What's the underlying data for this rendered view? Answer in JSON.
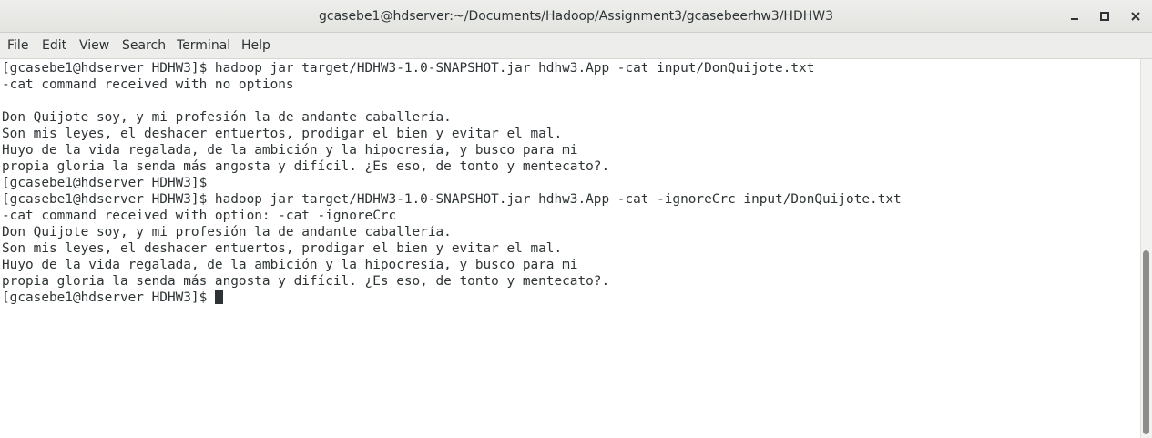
{
  "window": {
    "title": "gcasebe1@hdserver:~/Documents/Hadoop/Assignment3/gcasebeerhw3/HDHW3",
    "controls": {
      "minimize_icon": "minimize-icon",
      "maximize_icon": "maximize-icon",
      "close_icon": "close-icon"
    }
  },
  "menubar": {
    "items": [
      "File",
      "Edit",
      "View",
      "Search",
      "Terminal",
      "Help"
    ]
  },
  "terminal": {
    "lines": [
      "[gcasebe1@hdserver HDHW3]$ hadoop jar target/HDHW3-1.0-SNAPSHOT.jar hdhw3.App -cat input/DonQuijote.txt",
      "-cat command received with no options",
      "",
      "Don Quijote soy, y mi profesión la de andante caballería.",
      "Son mis leyes, el deshacer entuertos, prodigar el bien y evitar el mal.",
      "Huyo de la vida regalada, de la ambición y la hipocresía, y busco para mi",
      "propia gloria la senda más angosta y difícil. ¿Es eso, de tonto y mentecato?.",
      "[gcasebe1@hdserver HDHW3]$",
      "[gcasebe1@hdserver HDHW3]$ hadoop jar target/HDHW3-1.0-SNAPSHOT.jar hdhw3.App -cat -ignoreCrc input/DonQuijote.txt",
      "-cat command received with option: -cat -ignoreCrc",
      "Don Quijote soy, y mi profesión la de andante caballería.",
      "Son mis leyes, el deshacer entuertos, prodigar el bien y evitar el mal.",
      "Huyo de la vida regalada, de la ambición y la hipocresía, y busco para mi",
      "propia gloria la senda más angosta y difícil. ¿Es eso, de tonto y mentecato?.",
      "[gcasebe1@hdserver HDHW3]$ "
    ]
  },
  "scrollbar": {
    "position_fraction": 0.5,
    "visible_fraction": 0.49
  },
  "colors": {
    "text": "#2e3436",
    "background": "#ffffff",
    "titlebar": "#e8e8e7"
  }
}
